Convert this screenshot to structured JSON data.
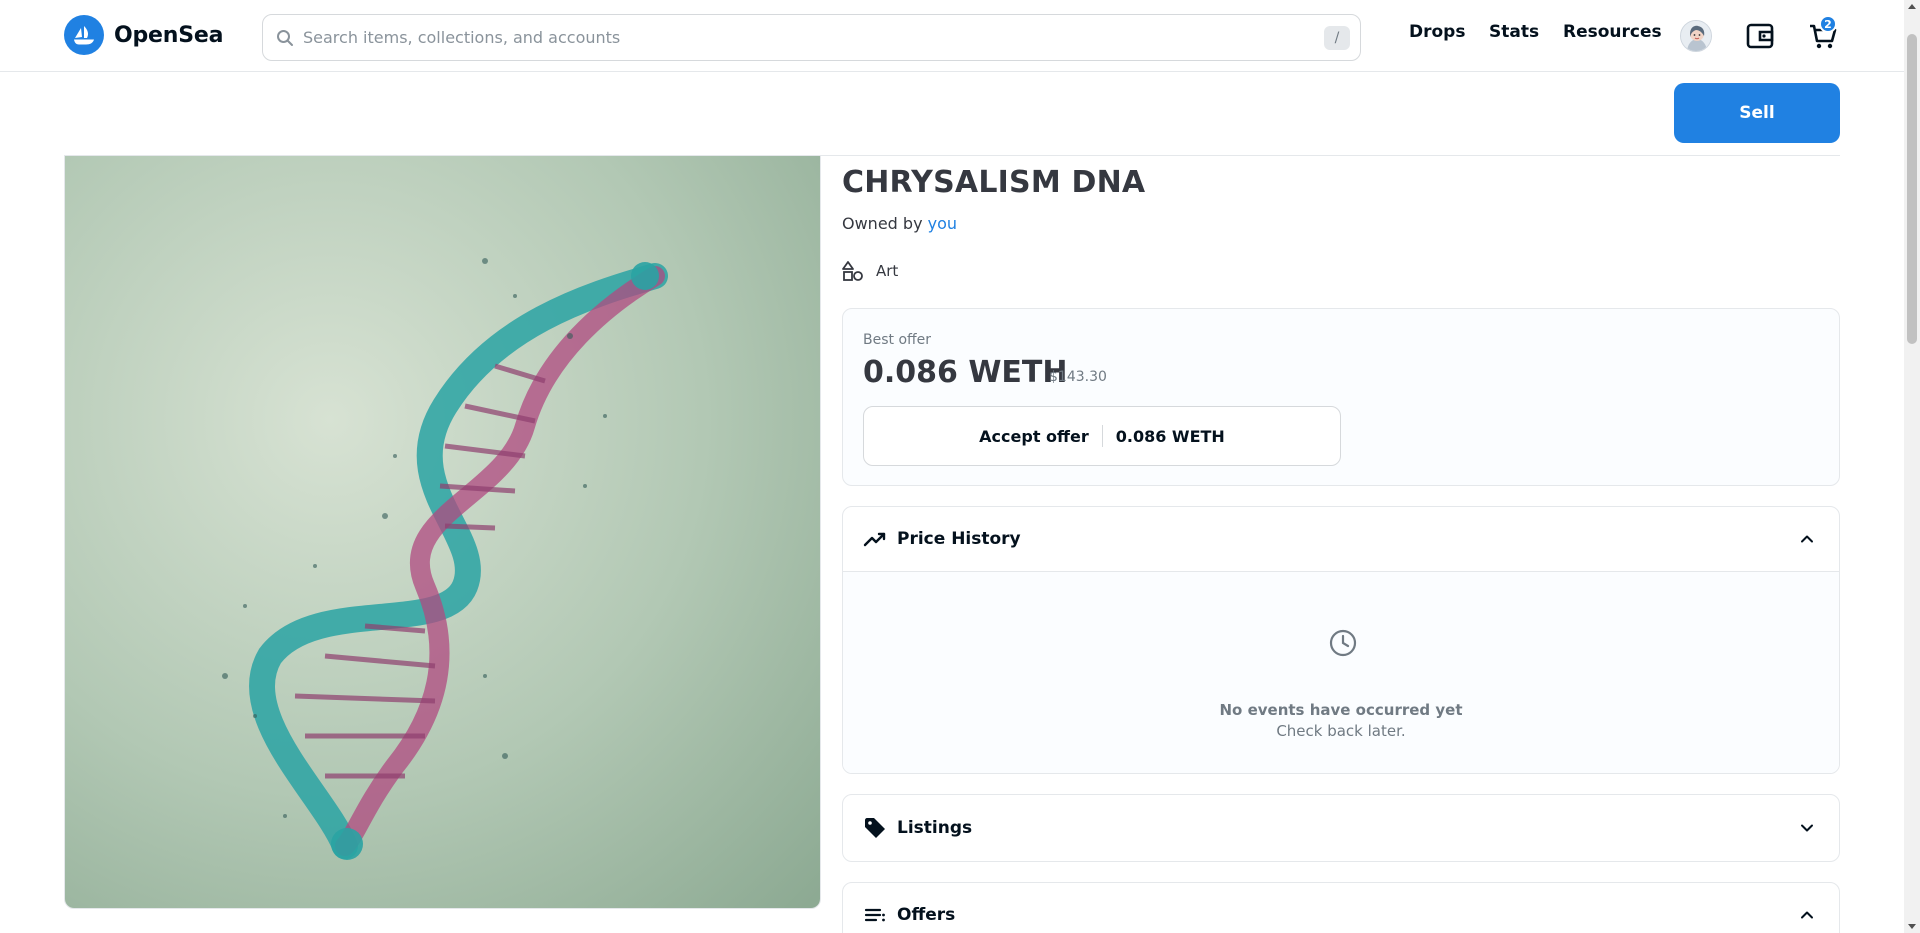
{
  "header": {
    "brand": "OpenSea",
    "search_placeholder": "Search items, collections, and accounts",
    "search_shortcut": "/",
    "nav": [
      "Drops",
      "Stats",
      "Resources"
    ],
    "cart_count": "2"
  },
  "toolbar": {
    "sell_label": "Sell"
  },
  "item": {
    "title": "CHRYSALISM DNA",
    "owned_by_prefix": "Owned by",
    "owner": "you",
    "category": "Art"
  },
  "best_offer": {
    "label": "Best offer",
    "price": "0.086 WETH",
    "usd": "$143.30",
    "accept_label": "Accept offer",
    "accept_amount": "0.086 WETH"
  },
  "panels": {
    "price_history": {
      "title": "Price History",
      "empty_title": "No events have occurred yet",
      "empty_sub": "Check back later."
    },
    "listings": {
      "title": "Listings"
    },
    "offers": {
      "title": "Offers"
    }
  },
  "colors": {
    "accent": "#2081e2",
    "text": "#04111d",
    "muted": "#707a83"
  }
}
